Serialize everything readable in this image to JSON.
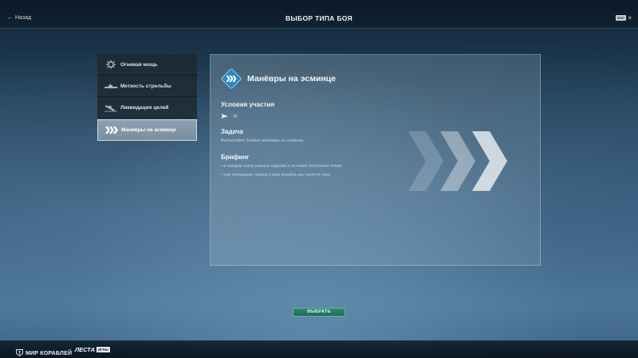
{
  "header": {
    "back_label": "Назад",
    "title": "ВЫБОР ТИПА БОЯ",
    "esc_key": "ESC"
  },
  "menu": {
    "items": [
      {
        "label": "Огневая мощь",
        "icon": "gun-turret-icon",
        "active": false
      },
      {
        "label": "Меткость стрельбы",
        "icon": "ship-silhouette-icon",
        "active": false
      },
      {
        "label": "Ликвидация целей",
        "icon": "sinking-ship-icon",
        "active": false
      },
      {
        "label": "Манёвры на эсминце",
        "icon": "triple-chevron-icon",
        "active": true
      }
    ]
  },
  "detail": {
    "title": "Манёвры на эсминце",
    "badge_icon": "triple-chevron-badge-icon",
    "conditions_heading": "Условия участия",
    "tier_icon": "destroyer-class-icon",
    "tier": "VI",
    "task_heading": "Задача",
    "task_text": "Выполняйте боевые манёвры на эсминце.",
    "briefing_heading": "Брифинг",
    "briefing_items": [
      "• в каждом этапе разные задания и условия получения очков;",
      "• при попадании торпед в ваш корабль вы теряете очки."
    ]
  },
  "actions": {
    "select_label": "ВЫБРАТЬ"
  },
  "footer": {
    "brand": "МИР КОРАБЛЕЙ",
    "publisher": "ЛЕСТА",
    "publisher_tag": "ИГРЫ"
  },
  "colors": {
    "accent_teal": "#1f6b58",
    "badge_blue": "#2a87c4",
    "active_item": "#8da1b0"
  }
}
